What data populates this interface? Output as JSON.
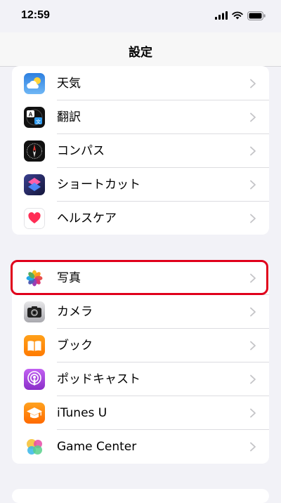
{
  "status": {
    "time": "12:59"
  },
  "nav": {
    "title": "設定"
  },
  "group1": [
    {
      "label": "天気"
    },
    {
      "label": "翻訳"
    },
    {
      "label": "コンパス"
    },
    {
      "label": "ショートカット"
    },
    {
      "label": "ヘルスケア"
    }
  ],
  "group2": [
    {
      "label": "写真"
    },
    {
      "label": "カメラ"
    },
    {
      "label": "ブック"
    },
    {
      "label": "ポッドキャスト"
    },
    {
      "label": "iTunes U"
    },
    {
      "label": "Game Center"
    }
  ],
  "highlight_color": "#e0001b"
}
